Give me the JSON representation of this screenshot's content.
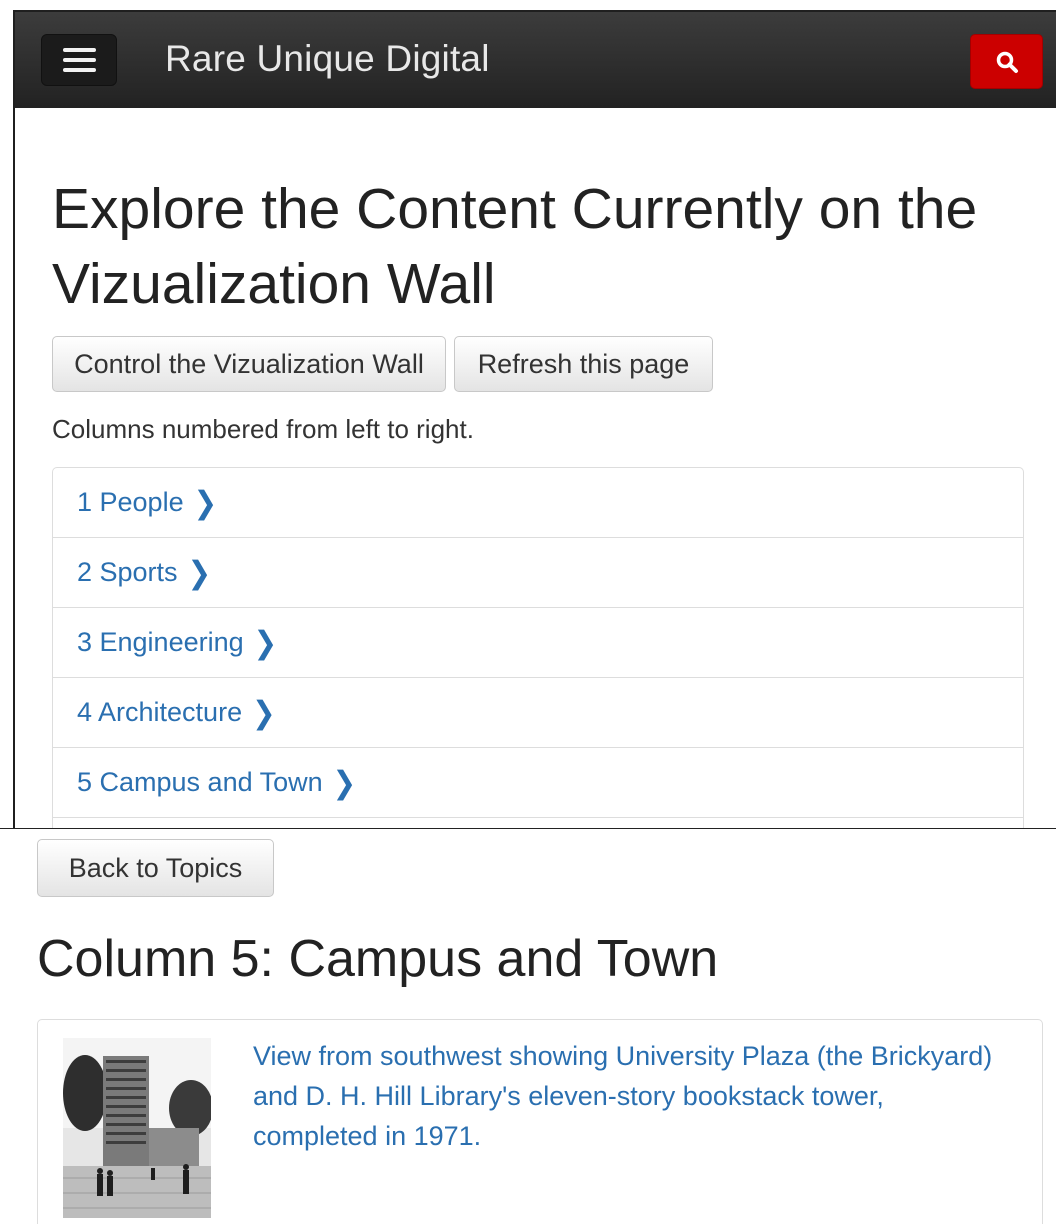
{
  "navbar": {
    "brand": "Rare Unique Digital",
    "menu_icon": "hamburger-menu-icon",
    "search_icon": "search-icon",
    "search_color": "#cc0000"
  },
  "main": {
    "title": "Explore the Content Currently on the Vizualization Wall",
    "buttons": {
      "control": "Control the Vizualization Wall",
      "refresh": "Refresh this page"
    },
    "note": "Columns numbered from left to right.",
    "topics": [
      {
        "label": "1 People"
      },
      {
        "label": "2 Sports"
      },
      {
        "label": "3 Engineering"
      },
      {
        "label": "4 Architecture"
      },
      {
        "label": "5 Campus and Town"
      }
    ]
  },
  "detail": {
    "back_label": "Back to Topics",
    "column_title": "Column 5: Campus and Town",
    "items": [
      {
        "caption": "View from southwest showing University Plaza (the Brickyard) and D. H. Hill Library's eleven-story bookstack tower, completed in 1971."
      }
    ]
  },
  "colors": {
    "link": "#2a6fb0",
    "navbar": "#2a2a2a"
  }
}
